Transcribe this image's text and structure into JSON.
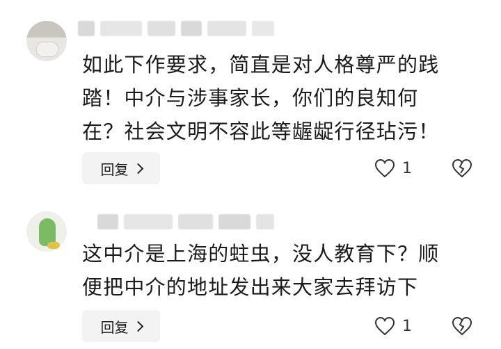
{
  "comments": [
    {
      "text_lines": [
        "如此下作要求，简直是对人格尊严的践",
        "踏！中介与涉事家长，你们的良知何",
        "在？社会文明不容此等龌龊行径玷污！"
      ],
      "reply_label": "回复",
      "like_count": "1"
    },
    {
      "text_lines": [
        "这中介是上海的蛀虫，没人教育下？顺",
        "便把中介的地址发出来大家去拜访下"
      ],
      "reply_label": "回复",
      "like_count": "1"
    }
  ],
  "icons": {
    "reply_chevron": "chevron-right-icon",
    "like": "heart-outline-icon",
    "dislike": "broken-heart-icon"
  }
}
